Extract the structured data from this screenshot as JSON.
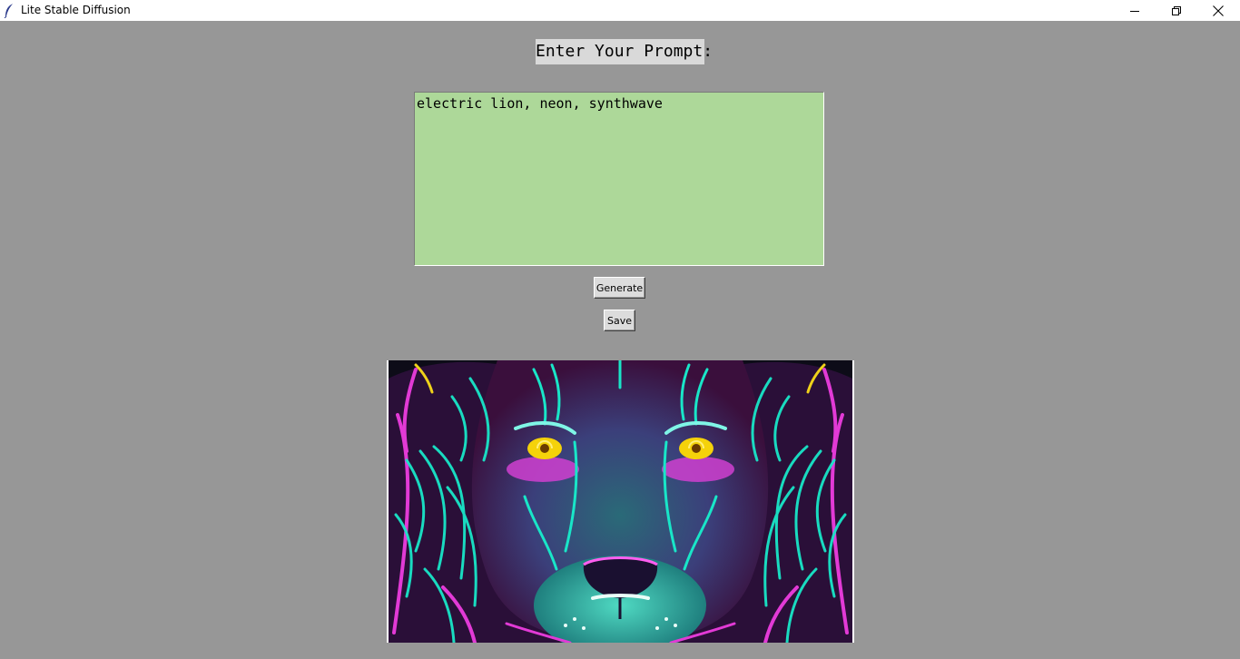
{
  "window": {
    "title": "Lite Stable Diffusion",
    "icon": "feather-icon",
    "controls": [
      "minimize-icon",
      "restore-icon",
      "close-icon"
    ]
  },
  "prompt": {
    "label": "Enter Your Prompt:",
    "value": "electric lion, neon, synthwave",
    "background": "#add899"
  },
  "buttons": {
    "generate_label": "Generate",
    "save_label": "Save"
  },
  "output_image": {
    "description_icon": "generated-lion-image",
    "colors": {
      "cyan": "#19e6c8",
      "magenta": "#e23ad6",
      "eye": "#f5d20a",
      "background": "#979797"
    }
  }
}
